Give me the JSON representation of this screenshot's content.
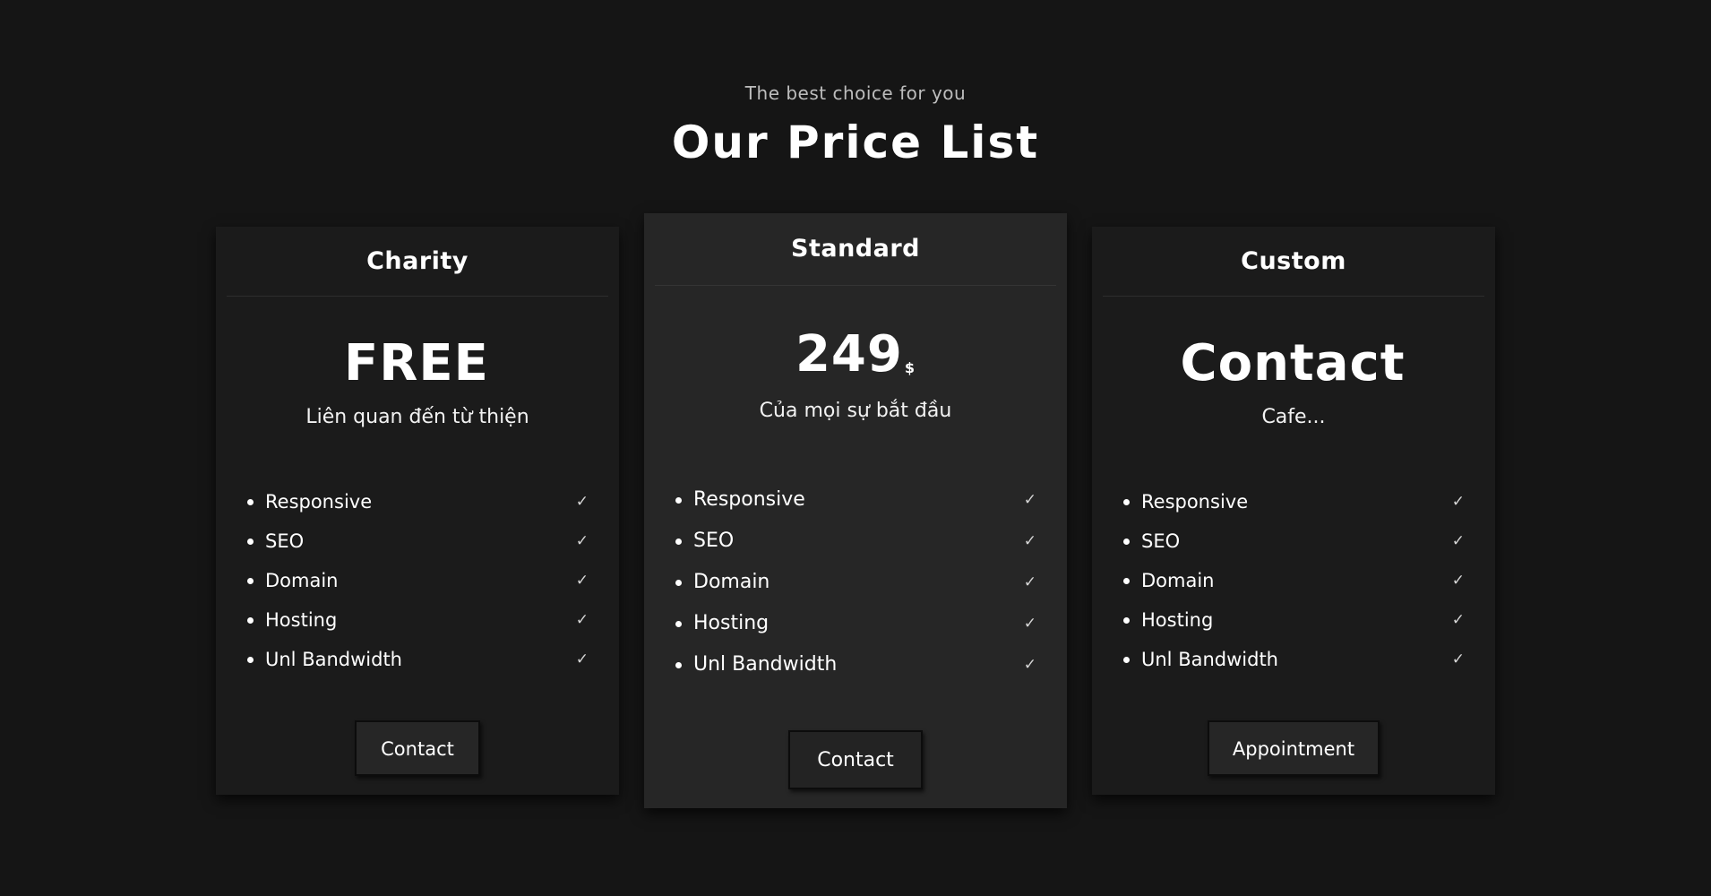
{
  "header": {
    "subtitle": "The best choice for you",
    "title": "Our Price List"
  },
  "plans": [
    {
      "name": "Charity",
      "price": "FREE",
      "currency": "",
      "description": "Liên quan đến từ thiện",
      "features": [
        "Responsive",
        "SEO",
        "Domain",
        "Hosting",
        "Unl Bandwidth"
      ],
      "check_icon": "check-icon",
      "button_label": "Contact"
    },
    {
      "name": "Standard",
      "price": "249",
      "currency": "$",
      "description": "Của mọi sự bắt đầu",
      "features": [
        "Responsive",
        "SEO",
        "Domain",
        "Hosting",
        "Unl Bandwidth"
      ],
      "check_icon": "check-icon",
      "button_label": "Contact"
    },
    {
      "name": "Custom",
      "price": "Contact",
      "currency": "",
      "description": "Cafe...",
      "features": [
        "Responsive",
        "SEO",
        "Domain",
        "Hosting",
        "Unl Bandwidth"
      ],
      "check_icon": "check-icon",
      "button_label": "Appointment"
    }
  ],
  "colors": {
    "background": "#151515",
    "card": "#1b1b1b",
    "card_featured": "#262626",
    "text": "#ffffff",
    "muted_text": "#bdbdbd"
  }
}
